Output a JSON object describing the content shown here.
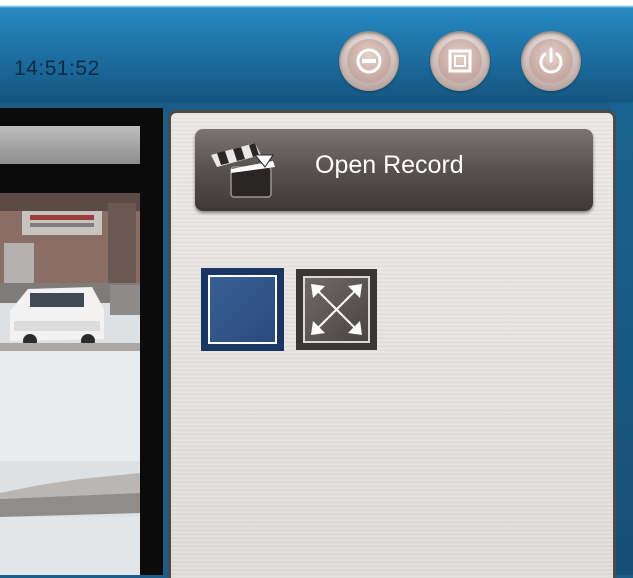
{
  "header": {
    "time": "14:51:52",
    "buttons": [
      {
        "icon": "minimize-icon"
      },
      {
        "icon": "maximize-icon"
      },
      {
        "icon": "power-icon"
      }
    ]
  },
  "right_panel": {
    "open_record_label": "Open Record",
    "open_record_icon": "clapperboard-icon",
    "layout_single_icon": "single-view-icon",
    "fullscreen_icon": "fullscreen-arrows-icon"
  },
  "colors": {
    "header_blue": "#1f77ac",
    "panel_bg": "#e1dedb",
    "button_dark": "#5a5452",
    "layout_blue": "#2a4b7c"
  }
}
